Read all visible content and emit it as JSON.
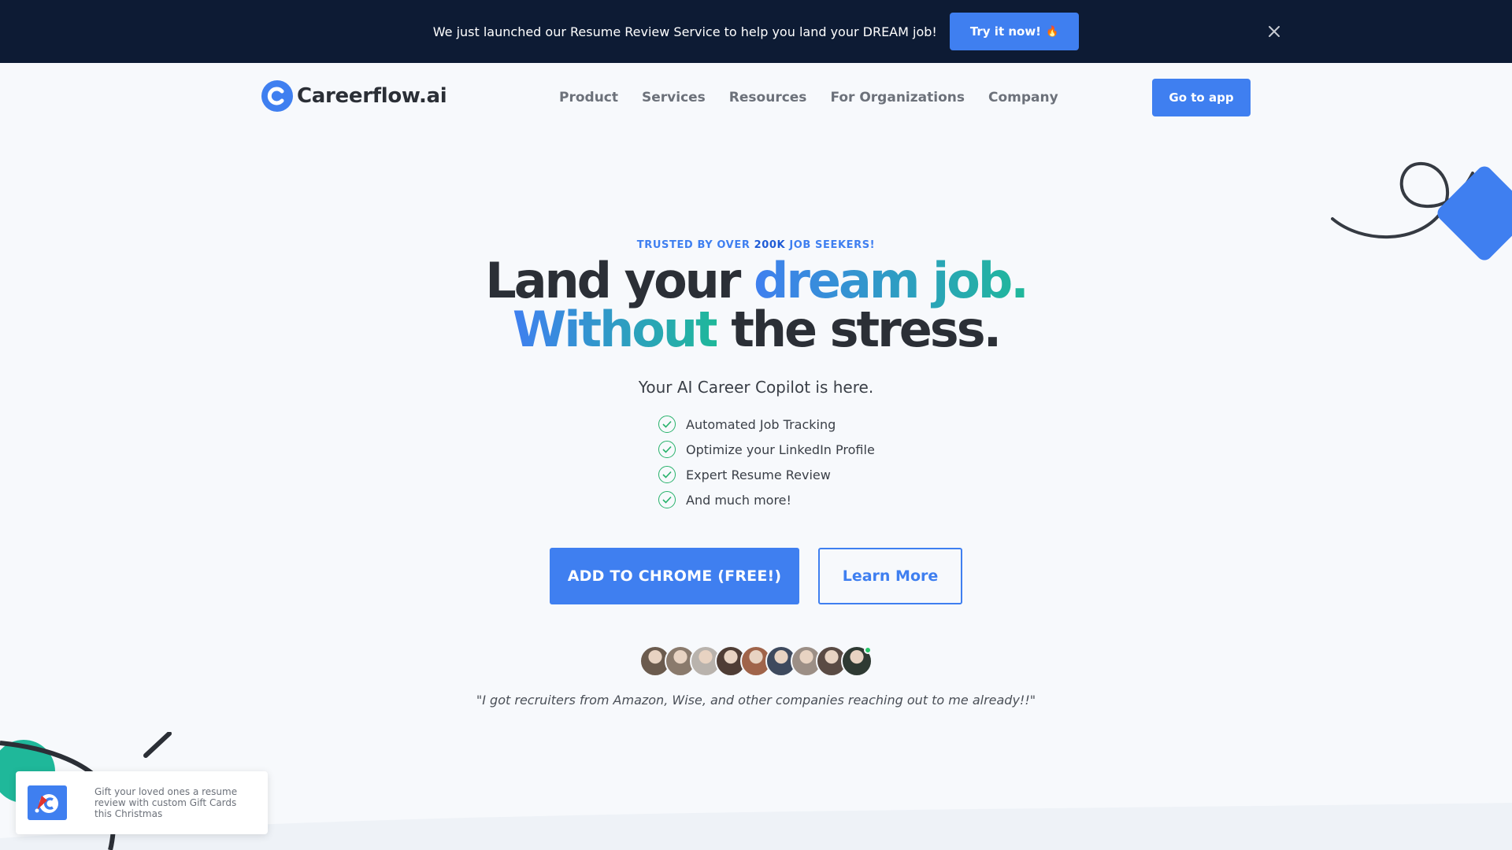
{
  "announcement": {
    "text": "We just launched our Resume Review Service to help you land your DREAM job!",
    "button_label": "Try it now!",
    "button_emoji": "🔥",
    "close_icon": "close-icon"
  },
  "nav": {
    "logo_text": "Careerflow.ai",
    "logo_letter": "C",
    "links": [
      "Product",
      "Services",
      "Resources",
      "For Organizations",
      "Company"
    ],
    "cta_label": "Go to app"
  },
  "hero": {
    "trusted_prefix": "TRUSTED BY OVER ",
    "trusted_count": "200K",
    "trusted_suffix": " JOB SEEKERS!",
    "headline_part1": "Land your ",
    "headline_part2": "dream job.",
    "headline_part3": "Without",
    "headline_part4": " the stress.",
    "subheadline": "Your AI Career Copilot is here.",
    "features": [
      "Automated Job Tracking",
      "Optimize your LinkedIn Profile",
      "Expert Resume Review",
      "And much more!"
    ],
    "primary_cta": "ADD TO CHROME  (FREE!)",
    "secondary_cta": "Learn More",
    "testimonial": "\"I got recruiters from Amazon, Wise, and other companies reaching out to me already!!\""
  },
  "avatars": {
    "count": 9,
    "colors": [
      "#6b5b4e",
      "#8a7a6c",
      "#b9b3ad",
      "#4f3d35",
      "#a0644a",
      "#3e4a5e",
      "#9c8f86",
      "#5a4b44",
      "#2f3a33"
    ]
  },
  "toast": {
    "text": "Gift your loved ones a resume review with custom Gift Cards this Christmas"
  },
  "colors": {
    "accent": "#3f7ff0",
    "teal": "#1fb89a",
    "navy": "#0d1b34",
    "check_green": "#27b26b"
  }
}
